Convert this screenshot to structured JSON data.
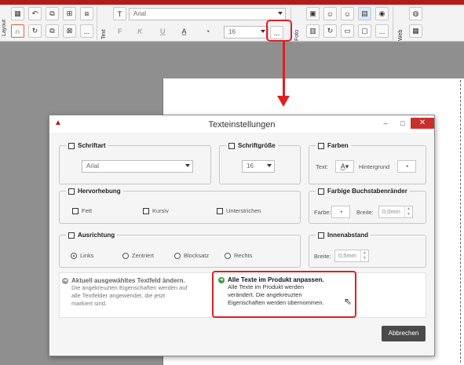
{
  "toolbar": {
    "section_layout": "Layout",
    "section_text": "Text",
    "section_foto": "Foto",
    "section_web": "Web",
    "font_value": "Arial",
    "size_value": "16",
    "bold": "F",
    "italic": "K",
    "underline": "U",
    "more": "...",
    "accent_color": "#b11b1b"
  },
  "dialog": {
    "title": "Texteinstellungen",
    "minimize": "–",
    "maximize": "□",
    "close": "✕",
    "schriftart": {
      "title": "Schriftart",
      "value": "Arial"
    },
    "schriftgroesse": {
      "title": "Schriftgröße",
      "value": "16"
    },
    "farben": {
      "title": "Farben",
      "text_label": "Text:",
      "bg_label": "Hintergrund"
    },
    "hervorhebung": {
      "title": "Hervorhebung",
      "fett": "Fett",
      "kursiv": "Kursiv",
      "unterstrichen": "Unterstrichen"
    },
    "buchstabenraender": {
      "title": "Farbige Buchstabenränder",
      "farbe_label": "Farbe:",
      "breite_label": "Breite:",
      "breite_value": "0,0mm"
    },
    "ausrichtung": {
      "title": "Ausrichtung",
      "links": "Links",
      "zentriert": "Zentriert",
      "blocksatz": "Blocksatz",
      "rechts": "Rechts",
      "selected": "Links"
    },
    "innenabstand": {
      "title": "Innenabstand",
      "breite_label": "Breite:",
      "breite_value": "0,5mm"
    },
    "option_current": {
      "title": "Aktuell ausgewähltes Textfeld ändern.",
      "line1": "Die angekreuzten Eigenschaften werden auf",
      "line2": "alle Textfelder angewendet, die jetzt",
      "line3": "markiert sind."
    },
    "option_all": {
      "title": "Alle Texte im Produkt anpassen.",
      "line1": "Alle Texte im Produkt werden",
      "line2": "verändert. Die angekreuzten",
      "line3": "Eigenschaften werden übernommen."
    },
    "cancel": "Abbrechen"
  }
}
